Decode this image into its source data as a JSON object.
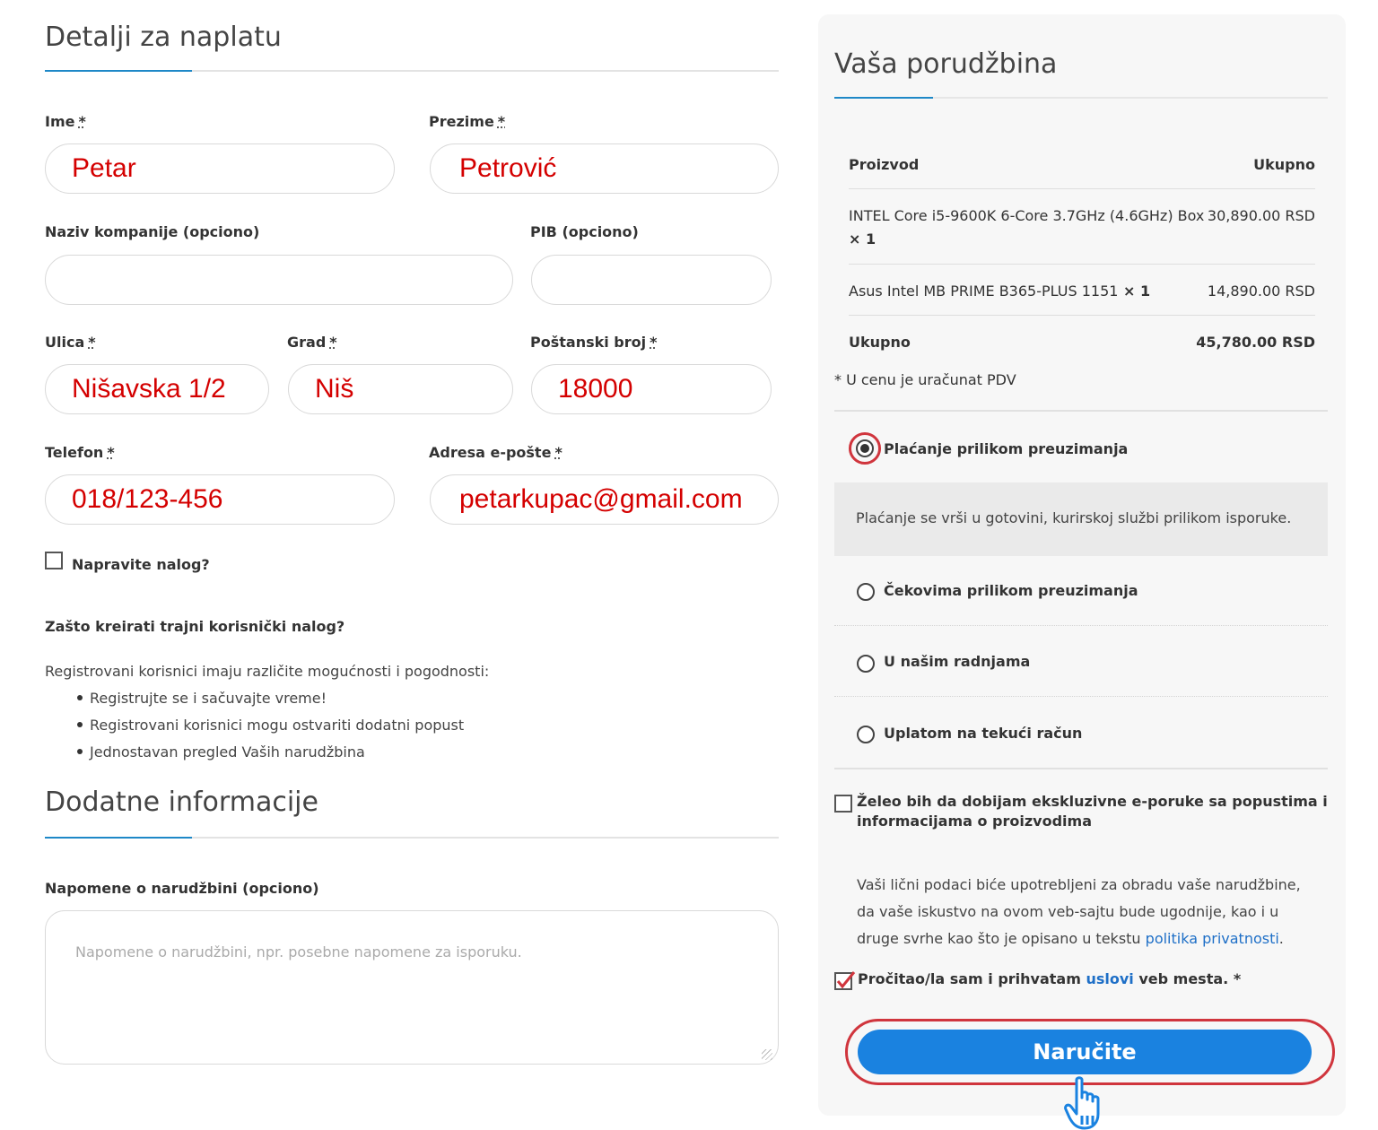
{
  "billing": {
    "title": "Detalji za naplatu",
    "first_name": {
      "label": "Ime",
      "required": "*",
      "value": "Petar"
    },
    "last_name": {
      "label": "Prezime",
      "required": "*",
      "value": "Petrović"
    },
    "company": {
      "label": "Naziv kompanije (opciono)",
      "value": ""
    },
    "pib": {
      "label": "PIB (opciono)",
      "value": ""
    },
    "street": {
      "label": "Ulica",
      "required": "*",
      "value": "Nišavska 1/2"
    },
    "city": {
      "label": "Grad",
      "required": "*",
      "value": "Niš"
    },
    "postal": {
      "label": "Poštanski broj",
      "required": "*",
      "value": "18000"
    },
    "phone": {
      "label": "Telefon",
      "required": "*",
      "value": "018/123-456"
    },
    "email": {
      "label": "Adresa e-pošte",
      "required": "*",
      "value": "petarkupac@gmail.com"
    },
    "create_account": {
      "label": "Napravite nalog?",
      "checked": false
    },
    "why_title": "Zašto kreirati trajni korisnički nalog?",
    "why_intro": "Registrovani korisnici imaju različite mogućnosti i pogodnosti:",
    "why_items": [
      "Registrujte se i sačuvajte vreme!",
      "Registrovani korisnici mogu ostvariti dodatni popust",
      "Jednostavan pregled Vaših narudžbina"
    ]
  },
  "additional": {
    "title": "Dodatne informacije",
    "notes_label": "Napomene o narudžbini (opciono)",
    "notes_placeholder": "Napomene o narudžbini, npr. posebne napomene za isporuku."
  },
  "order": {
    "title": "Vaša porudžbina",
    "col_product": "Proizvod",
    "col_total": "Ukupno",
    "items": [
      {
        "name_line1": "INTEL Core i5-9600K 6-Core 3.7GHz (4.6GHz) Box",
        "qty": "× 1",
        "total": "30,890.00 RSD"
      },
      {
        "name_line1": "Asus Intel MB PRIME B365-PLUS 1151",
        "qty": "× 1",
        "total": "14,890.00 RSD"
      }
    ],
    "total_label": "Ukupno",
    "total_value": "45,780.00 RSD",
    "vat_note": "* U cenu je uračunat PDV"
  },
  "payment": {
    "methods": [
      {
        "label": "Plaćanje prilikom preuzimanja",
        "selected": true
      },
      {
        "label": "Čekovima prilikom preuzimanja",
        "selected": false
      },
      {
        "label": "U našim radnjama",
        "selected": false
      },
      {
        "label": "Uplatom na tekući račun",
        "selected": false
      }
    ],
    "selected_description": "Plaćanje se vrši u gotovini, kurirskoj službi prilikom isporuke."
  },
  "newsletter": {
    "line1": "Želeo bih da dobijam ekskluzivne e-poruke sa popustima i",
    "line2": "informacijama o proizvodima",
    "checked": false
  },
  "privacy": {
    "line1": "Vaši lični podaci biće upotrebljeni za obradu vaše narudžbine,",
    "line2": "da vaše iskustvo na ovom veb-sajtu bude ugodnije, kao i u",
    "line3_prefix": "druge svrhe kao što je opisano u tekstu ",
    "line3_link": "politika privatnosti",
    "line3_suffix": "."
  },
  "terms": {
    "prefix": "Pročitao/la sam i prihvatam ",
    "link": "uslovi",
    "suffix": " veb mesta.",
    "required": "*",
    "checked": true
  },
  "submit_label": "Naručite",
  "colors": {
    "accent": "#1e88c7",
    "button": "#1a82e0",
    "highlight": "#d0353d",
    "input_text": "#d40000"
  }
}
